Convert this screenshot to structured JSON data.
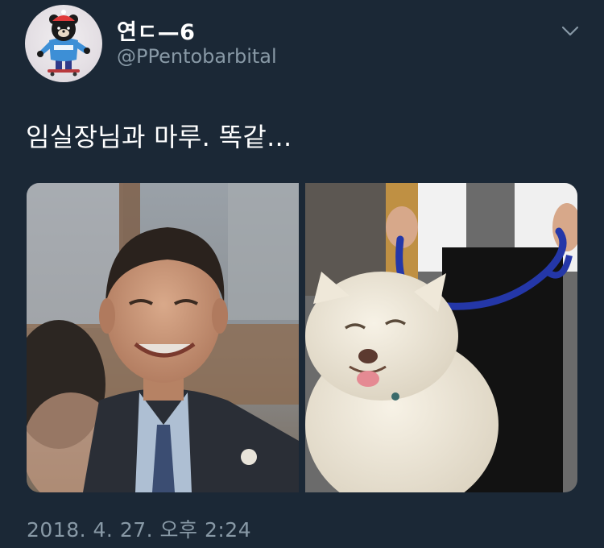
{
  "tweet": {
    "author": {
      "display_name": "연ㄷ—6",
      "handle": "@PPentobarbital",
      "avatar_icon": "bear-mascot-avatar"
    },
    "text": "임실장님과 마루. 똑같...",
    "media": [
      {
        "description_icon": "smiling-man-in-suit-photo"
      },
      {
        "description_icon": "smiling-white-dog-on-leash-photo"
      }
    ],
    "timestamp": "2018. 4. 27. 오후 2:24"
  },
  "icons": {
    "more_options": "chevron-down-icon"
  },
  "colors": {
    "background": "#1b2836",
    "secondary_text": "#8899a6",
    "primary_text": "#ffffff"
  }
}
